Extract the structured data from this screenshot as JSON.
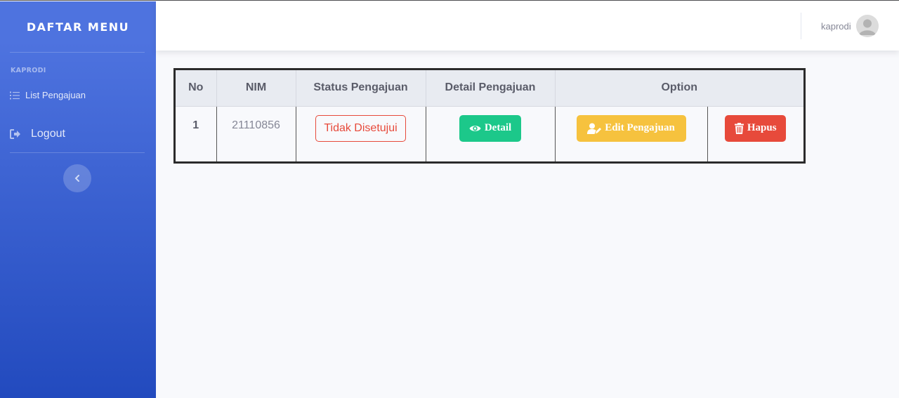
{
  "sidebar": {
    "brand": "DAFTAR MENU",
    "heading": "KAPRODI",
    "items": [
      {
        "label": "List Pengajuan",
        "icon": "list-icon"
      },
      {
        "label": "Logout",
        "icon": "sign-out-icon"
      }
    ],
    "toggle_icon": "chevron-left-icon"
  },
  "topbar": {
    "username": "kaprodi",
    "avatar_icon": "user-avatar-icon"
  },
  "table": {
    "headers": [
      "No",
      "NIM",
      "Status Pengajuan",
      "Detail Pengajuan",
      "Option"
    ],
    "rows": [
      {
        "no": "1",
        "nim": "21110856",
        "status": "Tidak Disetujui",
        "detail_label": "Detail",
        "edit_label": "Edit Pengajuan",
        "delete_label": "Hapus"
      }
    ]
  },
  "colors": {
    "sidebar_top": "#4e73df",
    "sidebar_bottom": "#224abe",
    "success": "#1cc88a",
    "warning": "#f6c23e",
    "danger": "#e74a3b"
  }
}
